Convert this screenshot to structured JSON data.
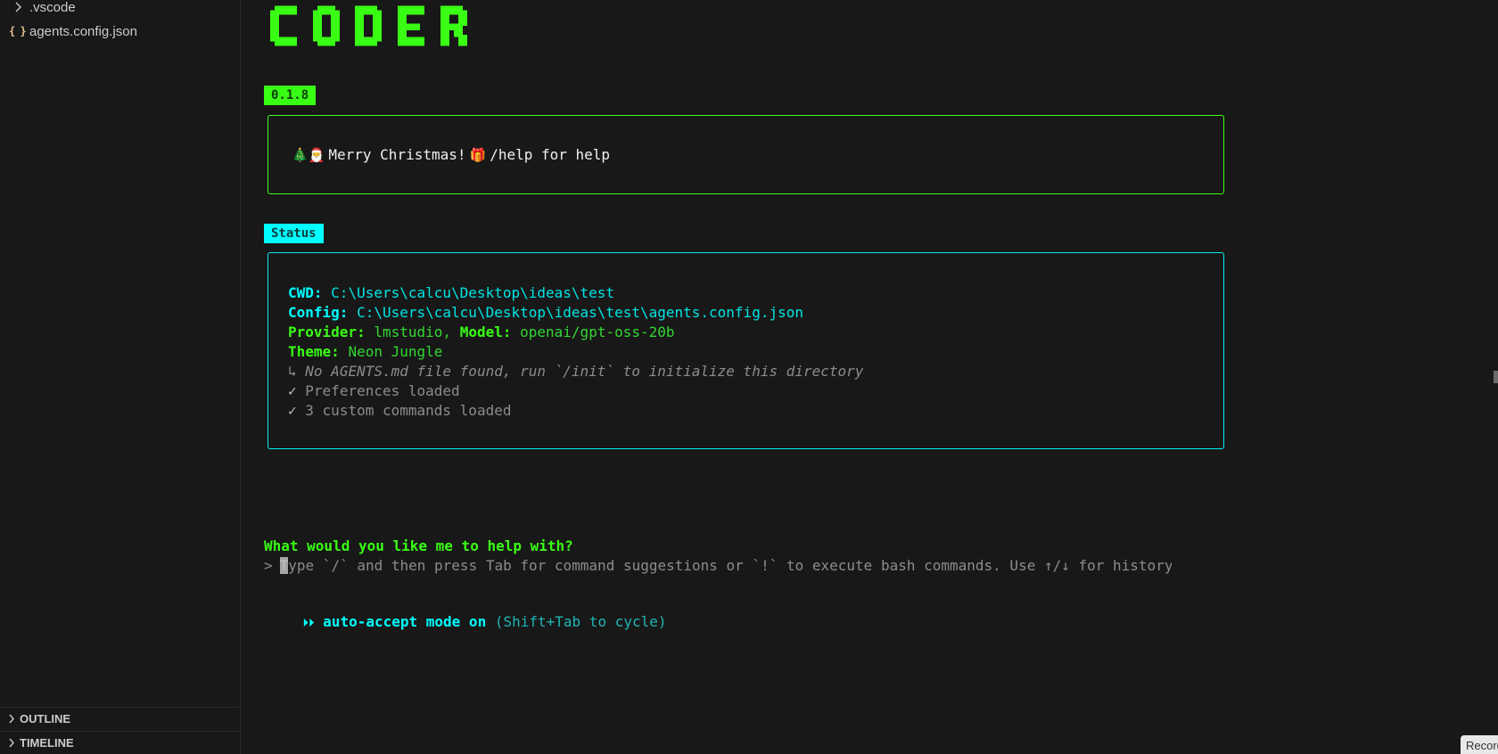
{
  "explorer": {
    "items": [
      {
        "label": ".vscode",
        "icon": "chevron-right-icon"
      },
      {
        "label": "agents.config.json",
        "icon": "json-file-icon"
      }
    ],
    "panels": [
      {
        "label": "OUTLINE"
      },
      {
        "label": "TIMELINE"
      }
    ]
  },
  "terminal": {
    "logo_text": "CODER",
    "version": "0.1.8",
    "welcome": {
      "emoji_tree": "🎄",
      "emoji_santa": "🎅",
      "text": "Merry Christmas!",
      "emoji_gift": "🎁",
      "help": "/help for help"
    },
    "status": {
      "title": "Status",
      "cwd_key": "CWD:",
      "cwd_value": "C:\\Users\\calcu\\Desktop\\ideas\\test",
      "config_key": "Config:",
      "config_value": "C:\\Users\\calcu\\Desktop\\ideas\\test\\agents.config.json",
      "provider_key": "Provider:",
      "provider_value": "lmstudio,",
      "model_key": "Model:",
      "model_value": "openai/gpt-oss-20b",
      "theme_key": "Theme:",
      "theme_value": "Neon Jungle",
      "notice_icon": "↳",
      "notice": "No AGENTS.md file found, run `/init` to initialize this directory",
      "check_icon": "✓",
      "prefs": "Preferences loaded",
      "commands": "3 custom commands loaded"
    },
    "prompt": {
      "question": "What would you like me to help with?",
      "caret": ">",
      "placeholder": "Type `/` and then press Tab for command suggestions or `!` to execute bash commands. Use ↑/↓ for history."
    },
    "mode": {
      "icon": "⏵⏵",
      "label": "auto-accept mode on",
      "hint": "(Shift+Tab to cycle)"
    }
  },
  "overlay": {
    "record_label": "Record"
  },
  "colors": {
    "neon_green": "#39ff14",
    "neon_cyan": "#00ffff",
    "background": "#181818"
  }
}
